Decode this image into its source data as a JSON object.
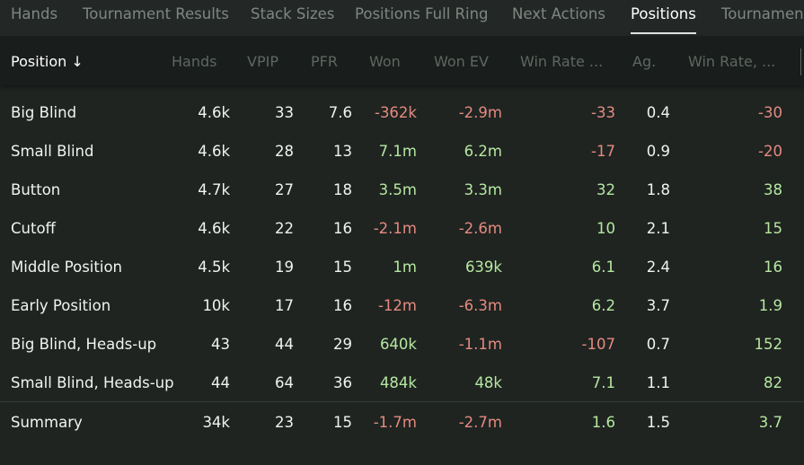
{
  "tabs": [
    {
      "label": "Hands",
      "active": false
    },
    {
      "label": "Tournament Results",
      "active": false
    },
    {
      "label": "Stack Sizes",
      "active": false
    },
    {
      "label": "Positions Full Ring",
      "active": false
    },
    {
      "label": "Next Actions",
      "active": false
    },
    {
      "label": "Positions",
      "active": true
    },
    {
      "label": "Tournament",
      "active": false
    }
  ],
  "table": {
    "columns": [
      "Position ↓",
      "Hands",
      "VPIP",
      "PFR",
      "Won",
      "Won EV",
      "Win Rate ...",
      "Ag.",
      "Win Rate, ..."
    ],
    "rows": [
      [
        "Big Blind",
        "4.6k",
        "33",
        "7.6",
        "-362k",
        "-2.9m",
        "-33",
        "0.4",
        "-30"
      ],
      [
        "Small Blind",
        "4.6k",
        "28",
        "13",
        "7.1m",
        "6.2m",
        "-17",
        "0.9",
        "-20"
      ],
      [
        "Button",
        "4.7k",
        "27",
        "18",
        "3.5m",
        "3.3m",
        "32",
        "1.8",
        "38"
      ],
      [
        "Cutoff",
        "4.6k",
        "22",
        "16",
        "-2.1m",
        "-2.6m",
        "10",
        "2.1",
        "15"
      ],
      [
        "Middle Position",
        "4.5k",
        "19",
        "15",
        "1m",
        "639k",
        "6.1",
        "2.4",
        "16"
      ],
      [
        "Early Position",
        "10k",
        "17",
        "16",
        "-12m",
        "-6.3m",
        "6.2",
        "3.7",
        "1.9"
      ],
      [
        "Big Blind, Heads-up",
        "43",
        "44",
        "29",
        "640k",
        "-1.1m",
        "-107",
        "0.7",
        "152"
      ],
      [
        "Small Blind, Heads-up",
        "44",
        "64",
        "36",
        "484k",
        "48k",
        "7.1",
        "1.1",
        "82"
      ]
    ],
    "summary": [
      "Summary",
      "34k",
      "23",
      "15",
      "-1.7m",
      "-2.7m",
      "1.6",
      "1.5",
      "3.7"
    ]
  },
  "colors": {
    "positive": "#b6e7a0",
    "negative": "#e58a80",
    "background": "#1f2421",
    "header_background": "#191d1b"
  }
}
